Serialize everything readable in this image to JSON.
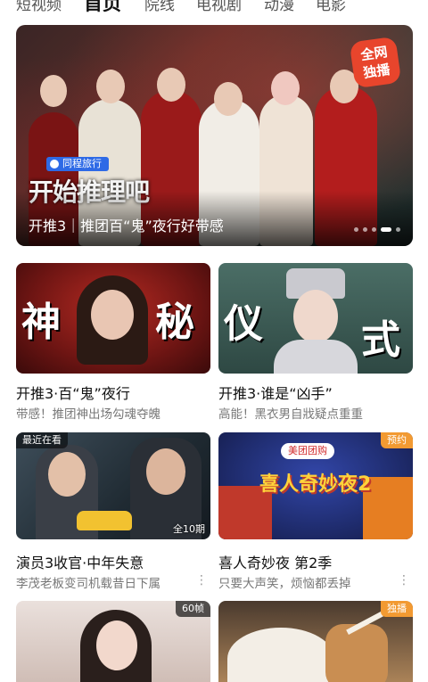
{
  "nav": {
    "tabs": [
      {
        "label": "短视频"
      },
      {
        "label": "首页"
      },
      {
        "label": "院线"
      },
      {
        "label": "电视剧"
      },
      {
        "label": "动漫"
      },
      {
        "label": "电影"
      }
    ]
  },
  "hero": {
    "caption": "开推3｜推团百“鬼”夜行好带感",
    "exclusive_badge": "全网\n独播",
    "sponsor_brand": "同程旅行",
    "show_logo_text": "开始推理吧",
    "page_count": 5,
    "active_page": 4
  },
  "cards": [
    {
      "title": "开推3·百“鬼”夜行",
      "subtitle": "带感！推团神出场勾魂夺魄",
      "overlay_chars": [
        "神",
        "秘"
      ],
      "colors": {
        "bg": "#6e1513"
      }
    },
    {
      "title": "开推3·谁是“凶手”",
      "subtitle": "高能！黑衣男自戕疑点重重",
      "overlay_chars": [
        "仪",
        "式"
      ],
      "colors": {
        "bg": "#3d5a55"
      }
    },
    {
      "title": "演员3收官·中年失意",
      "subtitle": "李茂老板变司机载昔日下属",
      "badge_tl": "最近在看",
      "badge_br": "全10期",
      "colors": {
        "bg": "#2a3a45"
      }
    },
    {
      "title": "喜人奇妙夜 第2季",
      "subtitle": "只要大声笑，烦恼都丢掉",
      "badge_tr": "预约",
      "logo_brand": "美团团购",
      "logo_text": "喜人奇妙夜2",
      "colors": {
        "bg": "#1f2c6e"
      }
    },
    {
      "badge_tr": "60帧",
      "colors": {
        "bg": "#d9c9c2"
      }
    },
    {
      "badge_tr": "独播",
      "colors": {
        "bg": "#c89a6a"
      }
    }
  ],
  "icons": {
    "more": "more-dots-icon"
  }
}
